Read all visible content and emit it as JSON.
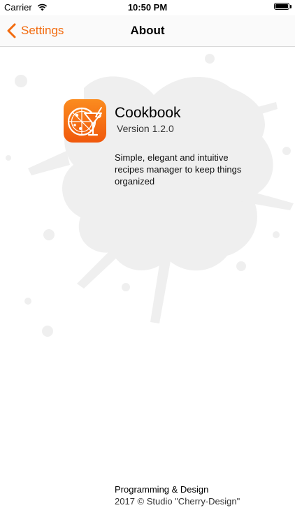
{
  "status_bar": {
    "carrier": "Carrier",
    "time": "10:50 PM"
  },
  "nav": {
    "back_label": "Settings",
    "title": "About"
  },
  "app": {
    "name": "Cookbook",
    "version": "Version 1.2.0",
    "description": "Simple, elegant and intuitive recipes manager to keep things organized",
    "icon": "pizza-cocktail-icon"
  },
  "footer": {
    "line1": "Programming & Design",
    "line2": "2017 © Studio \"Cherry-Design\""
  },
  "colors": {
    "accent": "#f26b0f",
    "splash": "#efefef"
  }
}
